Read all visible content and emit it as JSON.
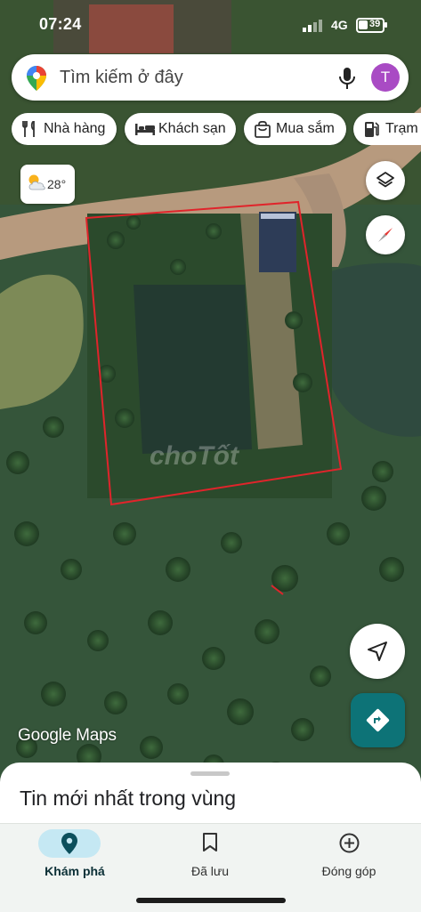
{
  "status": {
    "time": "07:24",
    "network": "4G",
    "battery": "39"
  },
  "search": {
    "placeholder": "Tìm kiếm ở đây",
    "avatar_letter": "T"
  },
  "chips": [
    {
      "label": "Nhà hàng",
      "icon": "fork-knife-icon"
    },
    {
      "label": "Khách sạn",
      "icon": "bed-icon"
    },
    {
      "label": "Mua sắm",
      "icon": "shopping-bag-icon"
    },
    {
      "label": "Trạm",
      "icon": "gas-station-icon"
    }
  ],
  "weather": {
    "temp": "28°",
    "icon": "partly-cloudy-icon"
  },
  "map": {
    "attribution": "Google Maps",
    "watermark": "choTốt",
    "boundary_color": "#e0242b"
  },
  "sheet": {
    "title": "Tin mới nhất trong vùng"
  },
  "nav": [
    {
      "label": "Khám phá",
      "icon": "explore-pin-icon",
      "active": true
    },
    {
      "label": "Đã lưu",
      "icon": "bookmark-icon",
      "active": false
    },
    {
      "label": "Đóng góp",
      "icon": "add-circle-icon",
      "active": false
    }
  ],
  "colors": {
    "directions_fab": "#0d7377",
    "active_pill": "#c5e8f3",
    "avatar": "#a94bc4"
  }
}
